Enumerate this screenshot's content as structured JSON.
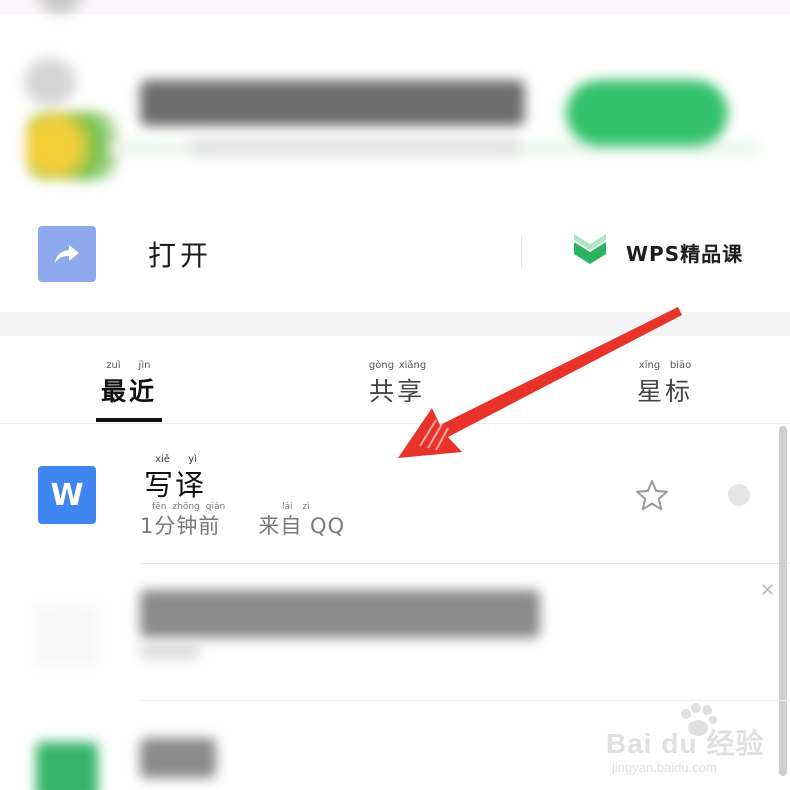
{
  "open_row": {
    "open_label": "打开",
    "wps_course_label": "WPS精品课"
  },
  "tabs": [
    {
      "label": "最近",
      "pinyin": [
        "zuì",
        "jìn"
      ],
      "active": true
    },
    {
      "label": "共享",
      "pinyin": [
        "gòng",
        "xiǎng"
      ],
      "active": false
    },
    {
      "label": "星标",
      "pinyin": [
        "xīng",
        "biāo"
      ],
      "active": false
    }
  ],
  "file": {
    "icon_letter": "W",
    "name": "写译",
    "name_pinyin": [
      "xiě",
      "yì"
    ],
    "time": "1分钟前",
    "time_pinyin": [
      "fēn",
      "zhōng",
      "qián"
    ],
    "source": "来自 QQ",
    "source_pinyin": [
      "lái",
      "zì"
    ]
  },
  "colors": {
    "accent_blue": "#3f86f0",
    "open_icon_blue": "#8fa9ee",
    "wps_green": "#2bb45f",
    "annotation_red": "#e8332a"
  },
  "icons": {
    "open": "share-arrow-icon",
    "wps": "wps-course-icon",
    "star": "star-outline-icon",
    "more": "more-dot-icon",
    "close": "close-icon"
  },
  "watermark": {
    "brand": "Bai du 经验",
    "url": "jingyan.baidu.com"
  }
}
